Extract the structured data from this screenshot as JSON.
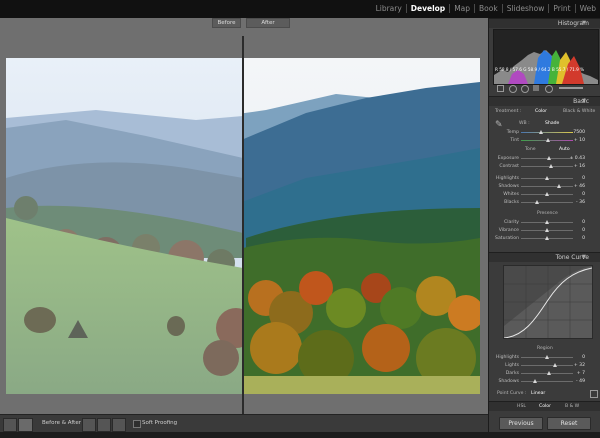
{
  "modules": [
    "Library",
    "Develop",
    "Map",
    "Book",
    "Slideshow",
    "Print",
    "Web"
  ],
  "active_module": "Develop",
  "view": {
    "before_label": "Before",
    "after_label": "After"
  },
  "toolbar": {
    "before_after_label": "Before & After :",
    "soft_proofing_label": "Soft Proofing"
  },
  "histogram": {
    "title": "Histogram",
    "readout": "R 58.8 / 57.6  G 58.9 / 64.2  B 55.7 / 71.9 %"
  },
  "basic": {
    "title": "Basic",
    "treatment_label": "Treatment :",
    "treatment_color": "Color",
    "treatment_bw": "Black & White",
    "wb_label": "WB :",
    "wb_value": "Shade",
    "temp_label": "Temp",
    "temp_value": "7500",
    "tint_label": "Tint",
    "tint_value": "+ 10",
    "tone_label": "Tone",
    "auto_label": "Auto",
    "exposure_label": "Exposure",
    "exposure_value": "+ 0.43",
    "contrast_label": "Contrast",
    "contrast_value": "+ 16",
    "highlights_label": "Highlights",
    "highlights_value": "0",
    "shadows_label": "Shadows",
    "shadows_value": "+ 46",
    "whites_label": "Whites",
    "whites_value": "0",
    "blacks_label": "Blacks",
    "blacks_value": "- 36",
    "presence_label": "Presence",
    "clarity_label": "Clarity",
    "clarity_value": "0",
    "vibrance_label": "Vibrance",
    "vibrance_value": "0",
    "saturation_label": "Saturation",
    "saturation_value": "0"
  },
  "tone_curve": {
    "title": "Tone Curve",
    "region_label": "Region",
    "highlights_label": "Highlights",
    "highlights_value": "0",
    "lights_label": "Lights",
    "lights_value": "+ 32",
    "darks_label": "Darks",
    "darks_value": "+ 7",
    "shadows_label": "Shadows",
    "shadows_value": "- 49",
    "point_curve_label": "Point Curve :",
    "point_curve_value": "Linear"
  },
  "hsl": {
    "hsl_label": "HSL",
    "color_label": "Color",
    "bw_label": "B & W"
  },
  "buttons": {
    "previous": "Previous",
    "reset": "Reset"
  }
}
